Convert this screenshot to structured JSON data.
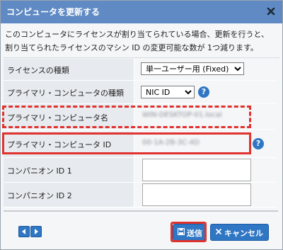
{
  "dialog": {
    "title": "コンピュータを更新する",
    "close_glyph": "✖"
  },
  "description": {
    "line1": "このコンピュータにライセンスが割り当てられている場合、更新を行うと、",
    "line2": "割り当てられたライセンスのマシン ID の変更可能な数が 1つ減ります。"
  },
  "form": {
    "license_type": {
      "label": "ライセンスの種類",
      "selected": "単一ユーザー用 (Fixed)"
    },
    "primary_computer_type": {
      "label": "プライマリ・コンピュータの種類",
      "selected": "NIC ID",
      "help_glyph": "?"
    },
    "primary_computer_name": {
      "label": "プライマリ・コンピュータ名",
      "value": "WIN-DESKTOP-01.local"
    },
    "primary_computer_id": {
      "label": "プライマリ・コンピュータ ID",
      "value": "00-1A-2B-3C-4D",
      "help_glyph": "?"
    },
    "companion_id_1": {
      "label": "コンパニオン ID 1",
      "value": ""
    },
    "companion_id_2": {
      "label": "コンパニオン ID 2",
      "value": ""
    }
  },
  "footer": {
    "send_label": "送信",
    "cancel_label": "キャンセル"
  },
  "colors": {
    "titlebar": "#5f8ac4",
    "button": "#2f76c4",
    "highlight": "#e0322e"
  }
}
